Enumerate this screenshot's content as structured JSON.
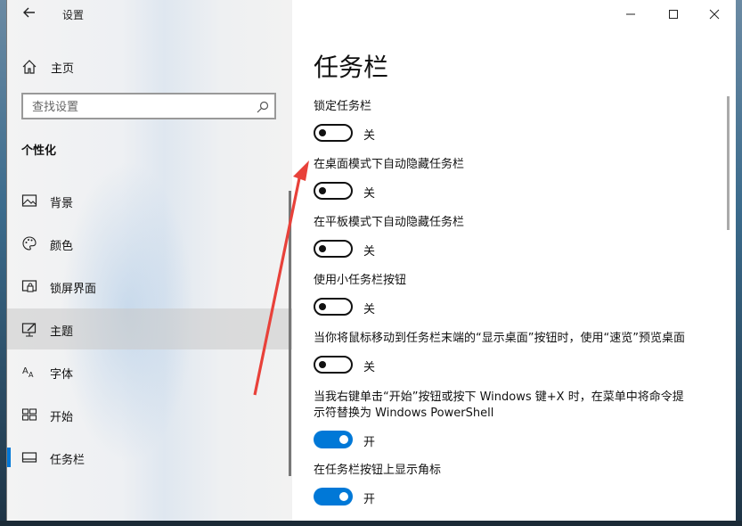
{
  "window": {
    "title": "设置"
  },
  "sidebar": {
    "home_label": "主页",
    "search_placeholder": "查找设置",
    "section_title": "个性化",
    "items": [
      {
        "label": "背景",
        "icon": "picture-icon"
      },
      {
        "label": "颜色",
        "icon": "palette-icon"
      },
      {
        "label": "锁屏界面",
        "icon": "lock-screen-icon"
      },
      {
        "label": "主题",
        "icon": "theme-icon"
      },
      {
        "label": "字体",
        "icon": "font-icon"
      },
      {
        "label": "开始",
        "icon": "start-icon"
      },
      {
        "label": "任务栏",
        "icon": "taskbar-icon"
      }
    ],
    "selected_item": "任务栏"
  },
  "main": {
    "title": "任务栏",
    "settings": [
      {
        "label": "锁定任务栏",
        "state": "off",
        "state_text": "关"
      },
      {
        "label": "在桌面模式下自动隐藏任务栏",
        "state": "off",
        "state_text": "关"
      },
      {
        "label": "在平板模式下自动隐藏任务栏",
        "state": "off",
        "state_text": "关"
      },
      {
        "label": "使用小任务栏按钮",
        "state": "off",
        "state_text": "关"
      },
      {
        "label": "当你将鼠标移动到任务栏末端的“显示桌面”按钮时，使用“速览”预览桌面",
        "state": "off",
        "state_text": "关"
      },
      {
        "label_line1": "当我右键单击“开始”按钮或按下 Windows 键+X 时，在菜单中将命令提",
        "label_line2": "示符替换为 Windows PowerShell",
        "state": "on",
        "state_text": "开"
      },
      {
        "label": "在任务栏按钮上显示角标",
        "state": "on",
        "state_text": "开"
      }
    ]
  },
  "colors": {
    "accent": "#0078d7",
    "annotation_arrow": "#e8413a"
  }
}
